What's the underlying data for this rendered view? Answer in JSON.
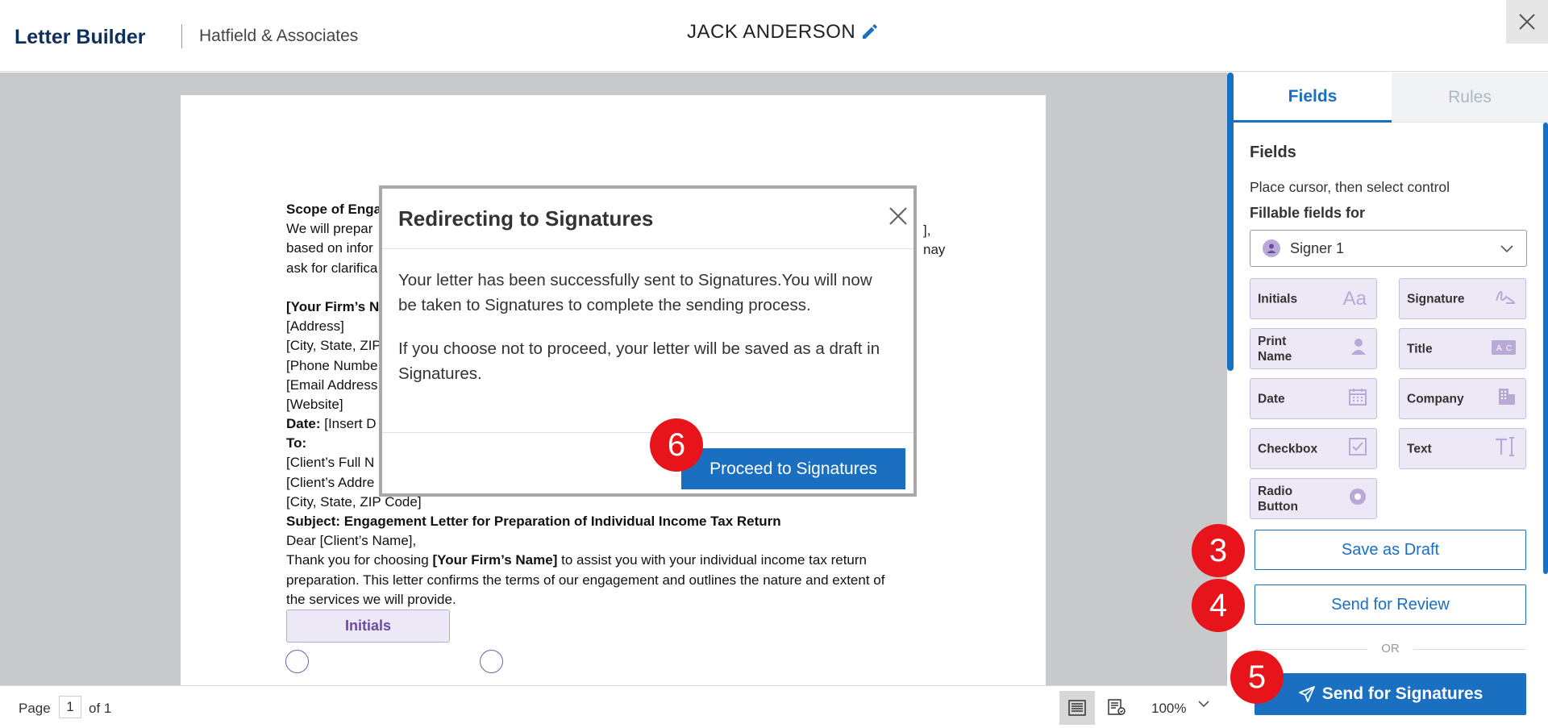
{
  "header": {
    "app_title": "Letter Builder",
    "firm_name": "Hatfield & Associates",
    "client_name": "JACK ANDERSON"
  },
  "document": {
    "lines": [
      [
        {
          "t": "Scope of Enga",
          "b": true
        }
      ],
      [
        {
          "t": "We will prepar",
          "b": false
        }
      ],
      [
        {
          "t": "based on infor",
          "b": false
        }
      ],
      [
        {
          "t": "ask for clarifica",
          "b": false
        }
      ],
      [
        {
          "t": "",
          "b": false
        }
      ],
      [
        {
          "t": "[Your Firm’s N",
          "b": true
        }
      ],
      [
        {
          "t": "[Address]",
          "b": false
        }
      ],
      [
        {
          "t": "[City, State, ZIP",
          "b": false
        }
      ],
      [
        {
          "t": "[Phone Numbe",
          "b": false
        }
      ],
      [
        {
          "t": "[Email Address",
          "b": false
        }
      ],
      [
        {
          "t": "[Website]",
          "b": false
        }
      ],
      [
        {
          "t": "Date:",
          "b": true
        },
        {
          "t": " [Insert D",
          "b": false
        }
      ],
      [
        {
          "t": "To:",
          "b": true
        }
      ],
      [
        {
          "t": "[Client’s Full N",
          "b": false
        }
      ],
      [
        {
          "t": "[Client’s Addre",
          "b": false
        }
      ],
      [
        {
          "t": "[City, State, ZIP Code]",
          "b": false
        }
      ],
      [
        {
          "t": "Subject: Engagement Letter for Preparation of Individual Income Tax Return",
          "b": true
        }
      ],
      [
        {
          "t": "Dear [Client’s Name],",
          "b": false
        }
      ],
      [
        {
          "t": "Thank you for choosing ",
          "b": false
        },
        {
          "t": "[Your Firm’s Name]",
          "b": true
        },
        {
          "t": " to assist you with your individual income tax return",
          "b": false
        }
      ],
      [
        {
          "t": "preparation. This letter confirms the terms of our engagement and outlines the nature and extent of",
          "b": false
        }
      ],
      [
        {
          "t": "the services we will provide.",
          "b": false
        }
      ]
    ],
    "right_fragment_1": "],",
    "right_fragment_2": "nay",
    "initials_field": "Initials"
  },
  "status_bar": {
    "page_label": "Page",
    "page_value": "1",
    "of_label": "of  1",
    "zoom": "100%"
  },
  "panel": {
    "tabs": [
      "Fields",
      "Rules"
    ],
    "heading": "Fields",
    "instruction": "Place cursor, then select control",
    "fillable_label": "Fillable fields for",
    "signer": "Signer 1",
    "fields": [
      {
        "label": "Initials",
        "icon": "initials-aa-icon"
      },
      {
        "label": "Signature",
        "icon": "signature-icon"
      },
      {
        "label": "Print Name",
        "icon": "person-icon"
      },
      {
        "label": "Title",
        "icon": "id-card-icon"
      },
      {
        "label": "Date",
        "icon": "calendar-icon"
      },
      {
        "label": "Company",
        "icon": "building-icon"
      },
      {
        "label": "Checkbox",
        "icon": "checkbox-icon"
      },
      {
        "label": "Text",
        "icon": "text-cursor-icon"
      },
      {
        "label": "Radio Button",
        "icon": "radio-icon"
      }
    ],
    "save_draft": "Save as Draft",
    "send_review": "Send for Review",
    "or_text": "OR",
    "send_signatures": "Send for Signatures"
  },
  "steps": {
    "three": "3",
    "four": "4",
    "five": "5",
    "six": "6"
  },
  "modal": {
    "title": "Redirecting to Signatures",
    "body1": "Your letter has been successfully sent to Signatures.You will now be taken to Signatures to complete the sending process.",
    "body2": "If you choose not to proceed, your letter will be saved as a draft in Signatures.",
    "proceed": "Proceed to Signatures"
  },
  "colors": {
    "accent": "#1a6fc0",
    "brand_dark": "#0d2f5c",
    "field_bg": "#ede8f6",
    "step_marker": "#e8141c"
  }
}
